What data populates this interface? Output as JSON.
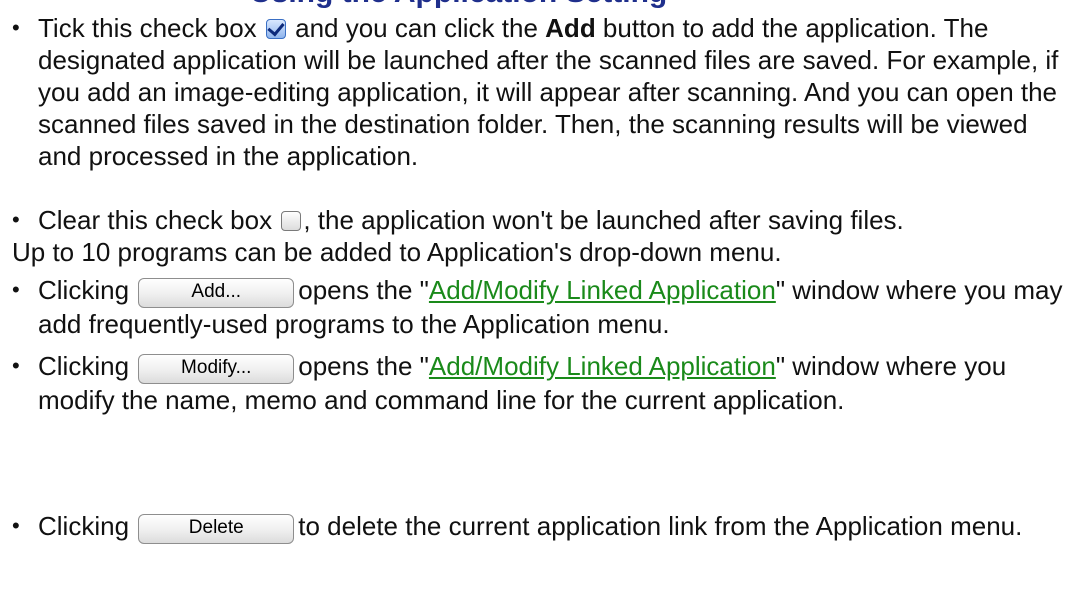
{
  "heading": "Using the Application Setting",
  "items": {
    "tick": {
      "part1": "Tick this check box ",
      "part2": " and you can click the ",
      "bold": "Add",
      "part3": " button to add the application.  The designated application will be launched after the scanned files are saved.  For example, if you add an image-editing application, it will appear after scanning.  And you can open the scanned files saved in the destination folder.  Then, the scanning results will be viewed and processed in the application."
    },
    "clear": {
      "part1": "Clear this check box ",
      "part2": ", the application won't be launched after saving files."
    },
    "note": "Up to 10 programs can be added to Application's drop-down menu.",
    "add": {
      "prefix": "Clicking ",
      "button": "Add...",
      "mid": "opens the \"",
      "link": "Add/Modify Linked Application",
      "suffix": "\" window where you may add frequently-used programs to the Application menu."
    },
    "modify": {
      "prefix": "Clicking ",
      "button": "Modify...",
      "mid": "opens the \"",
      "link": "Add/Modify Linked Application",
      "suffix": "\" window where you modify the name, memo and command line for the current application."
    },
    "delete": {
      "prefix": "Clicking ",
      "button": "Delete",
      "suffix": "to delete the current application link from the Application menu."
    }
  },
  "bullet": "•",
  "colors": {
    "heading": "#1f2f8c",
    "link": "#1a8a1a"
  }
}
